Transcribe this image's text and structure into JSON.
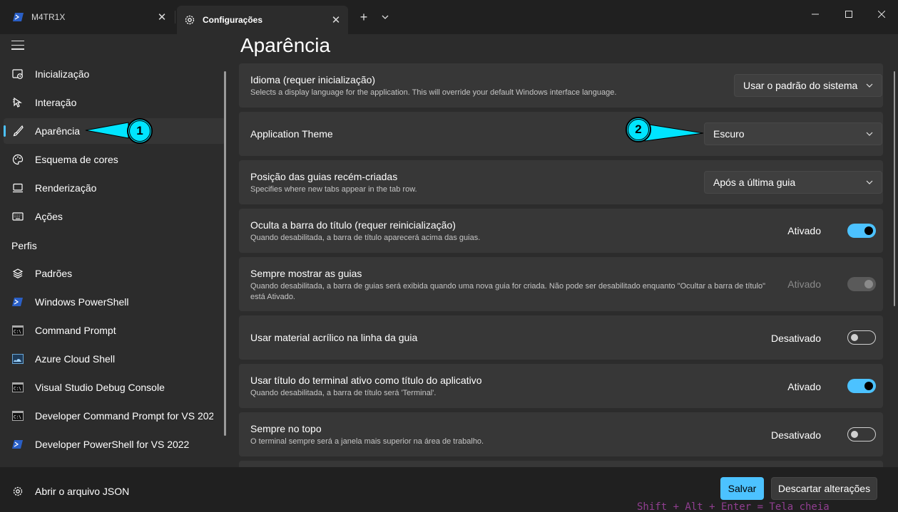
{
  "titlebar": {
    "tabs": [
      {
        "label": "M4TR1X",
        "icon": "powershell-icon"
      },
      {
        "label": "Configurações",
        "icon": "gear-icon"
      }
    ],
    "new_tab": "+",
    "window_controls": [
      "minimize",
      "maximize",
      "close"
    ]
  },
  "sidebar": {
    "items_top": [
      {
        "label": "Inicialização",
        "icon": "startup-icon"
      },
      {
        "label": "Interação",
        "icon": "cursor-icon"
      },
      {
        "label": "Aparência",
        "icon": "brush-icon",
        "selected": true
      },
      {
        "label": "Esquema de cores",
        "icon": "palette-icon"
      },
      {
        "label": "Renderização",
        "icon": "monitor-icon"
      },
      {
        "label": "Ações",
        "icon": "keyboard-icon"
      }
    ],
    "profiles_heading": "Perfis",
    "profiles": [
      {
        "label": "Padrões",
        "icon": "layers-icon"
      },
      {
        "label": "Windows PowerShell",
        "icon": "powershell-icon"
      },
      {
        "label": "Command Prompt",
        "icon": "cmd-icon"
      },
      {
        "label": "Azure Cloud Shell",
        "icon": "azure-icon"
      },
      {
        "label": "Visual Studio Debug Console",
        "icon": "cmd-icon"
      },
      {
        "label": "Developer Command Prompt for VS 2022",
        "icon": "cmd-icon"
      },
      {
        "label": "Developer PowerShell for VS 2022",
        "icon": "powershell-icon"
      }
    ],
    "open_json": "Abrir o arquivo JSON"
  },
  "main": {
    "title": "Aparência",
    "settings": [
      {
        "title": "Idioma (requer inicialização)",
        "desc": "Selects a display language for the application. This will override your default Windows interface language.",
        "control": "dropdown",
        "value": "Usar o padrão do sistema"
      },
      {
        "title": "Application Theme",
        "desc": "",
        "control": "dropdown",
        "value": "Escuro"
      },
      {
        "title": "Posição das guias recém-criadas",
        "desc": "Specifies where new tabs appear in the tab row.",
        "control": "dropdown",
        "value": "Após a última guia"
      },
      {
        "title": "Oculta a barra do título (requer reinicialização)",
        "desc": "Quando desabilitada, a barra de título aparecerá acima das guias.",
        "control": "toggle",
        "state": "Ativado",
        "on": true
      },
      {
        "title": "Sempre mostrar as guias",
        "desc": "Quando desabilitada, a barra de guias será exibida quando uma nova guia for criada. Não pode ser desabilitado enquanto \"Ocultar a barra de título\" está Ativado.",
        "control": "toggle",
        "state": "Ativado",
        "on": true,
        "disabled": true
      },
      {
        "title": "Usar material acrílico na linha da guia",
        "desc": "",
        "control": "toggle",
        "state": "Desativado",
        "on": false
      },
      {
        "title": "Usar título do terminal ativo como título do aplicativo",
        "desc": "Quando desabilitada, a barra de título será 'Terminal'.",
        "control": "toggle",
        "state": "Ativado",
        "on": true
      },
      {
        "title": "Sempre no topo",
        "desc": "O terminal sempre será a janela mais superior na área de trabalho.",
        "control": "toggle",
        "state": "Desativado",
        "on": false
      }
    ]
  },
  "footer": {
    "save": "Salvar",
    "discard": "Descartar alterações"
  },
  "background_text": "Shift + Alt + Enter = Tela cheia",
  "annotations": [
    "1",
    "2"
  ],
  "colors": {
    "accent": "#4cc2ff",
    "annotation": "#00e5ff"
  }
}
